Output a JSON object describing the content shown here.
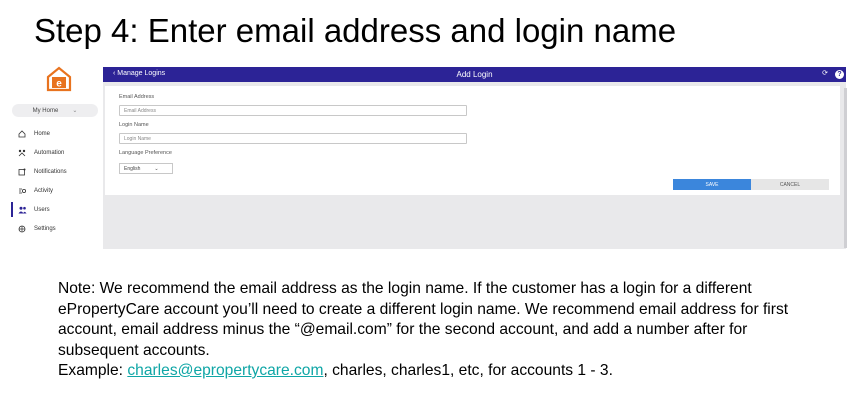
{
  "slide": {
    "title": "Step 4: Enter email address and login name"
  },
  "app": {
    "home_selector": "My Home",
    "nav": [
      {
        "label": "Home",
        "icon": "home-icon"
      },
      {
        "label": "Automation",
        "icon": "automation-icon"
      },
      {
        "label": "Notifications",
        "icon": "notifications-icon"
      },
      {
        "label": "Activity",
        "icon": "activity-icon"
      },
      {
        "label": "Users",
        "icon": "users-icon",
        "active": true
      },
      {
        "label": "Settings",
        "icon": "settings-icon"
      }
    ],
    "header": {
      "back_label": "‹ Manage Logins",
      "title": "Add Login",
      "refresh_icon": "⟳",
      "help_icon": "?"
    },
    "form": {
      "email_label": "Email Address",
      "email_placeholder": "Email Address",
      "login_label": "Login Name",
      "login_placeholder": "Login Name",
      "language_label": "Language Preference",
      "language_value": "English",
      "save_label": "SAVE",
      "cancel_label": "CANCEL"
    },
    "colors": {
      "header": "#2c2396",
      "save_button": "#3b86dc",
      "logo_orange": "#e8731f"
    }
  },
  "note": {
    "text1": "Note: We recommend the email address as the login name. If the customer has a login for a different ePropertyCare account you’ll need to create a different login name. We recommend email address for first account, email address minus the “@email.com” for the second account, and add a number after for subsequent accounts.",
    "example_prefix": "Example: ",
    "example_link": "charles@epropertycare.com",
    "example_suffix": ", charles, charles1, etc, for accounts 1 - 3."
  }
}
